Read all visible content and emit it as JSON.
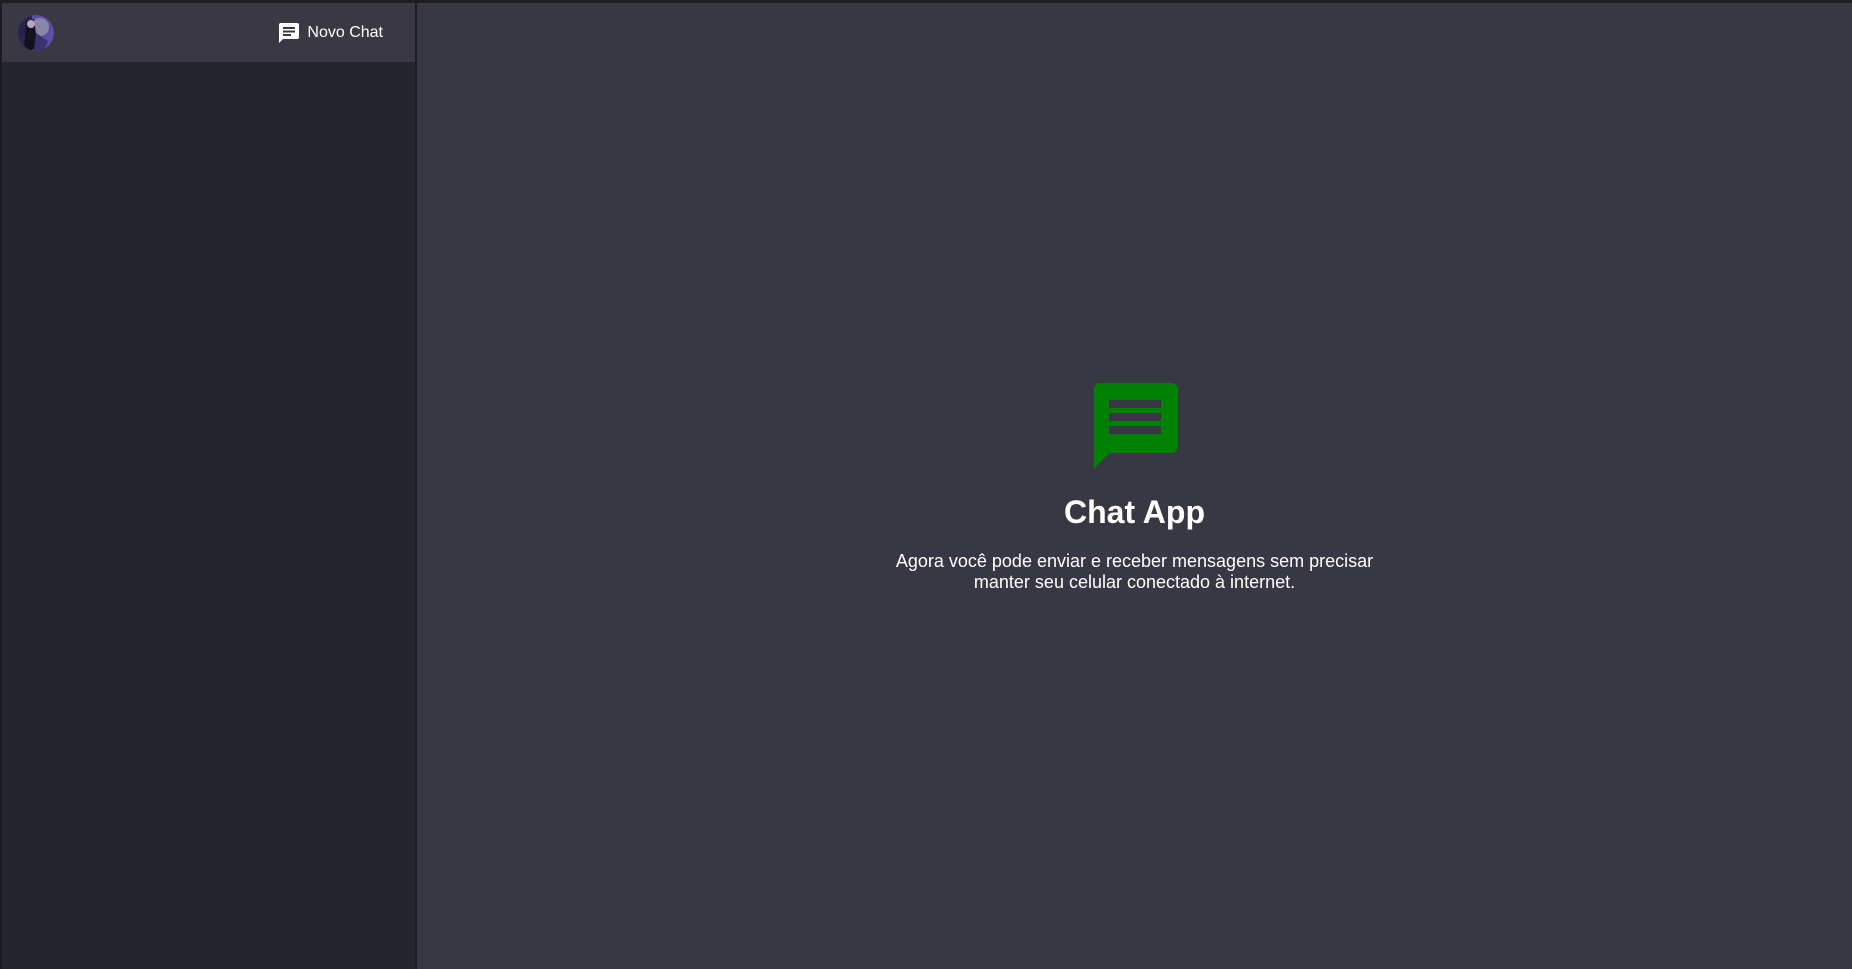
{
  "sidebar": {
    "new_chat_label": "Novo Chat",
    "new_chat_icon": "chat-bubble-icon",
    "avatar_icon": "user-avatar"
  },
  "welcome": {
    "icon": "chat-bubble-icon",
    "icon_color": "#008000",
    "title": "Chat App",
    "text": "Agora você pode enviar e receber mensagens sem precisar manter seu celular conectado à internet."
  },
  "colors": {
    "sidebar_bg": "#25252d",
    "sidebar_header_bg": "#393843",
    "main_bg": "#383844",
    "accent": "#008000"
  }
}
